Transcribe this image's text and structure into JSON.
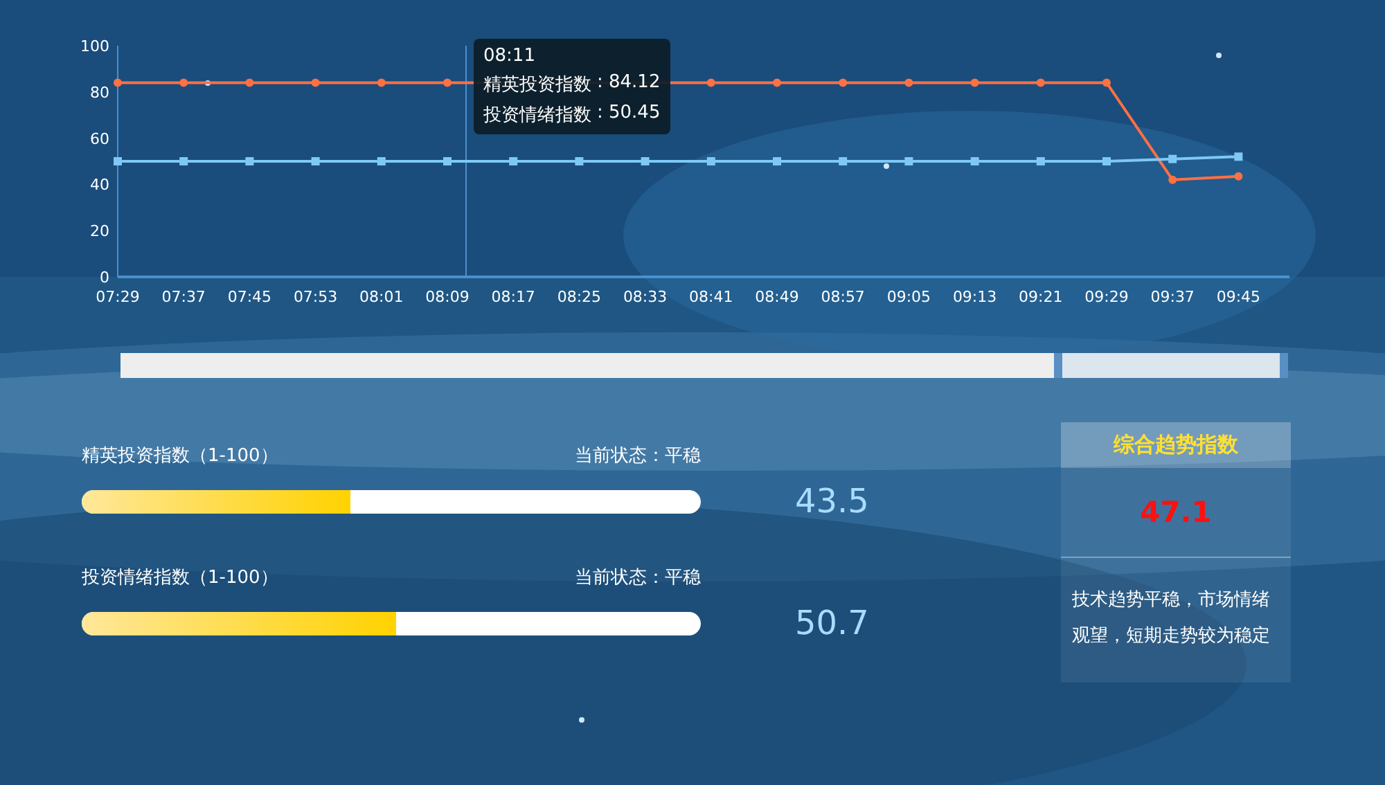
{
  "chart": {
    "chart_data": {
      "type": "line",
      "categories": [
        "07:29",
        "07:37",
        "07:45",
        "07:53",
        "08:01",
        "08:09",
        "08:17",
        "08:25",
        "08:33",
        "08:41",
        "08:49",
        "08:57",
        "09:05",
        "09:13",
        "09:21",
        "09:29",
        "09:37",
        "09:45"
      ],
      "series": [
        {
          "name": "精英投资指数",
          "color": "#ff7043",
          "marker": "circle",
          "values": [
            84,
            84,
            84,
            84,
            84,
            84,
            null,
            null,
            null,
            84,
            84,
            84,
            84,
            84,
            84,
            84,
            42,
            43.5
          ]
        },
        {
          "name": "投资情绪指数",
          "color": "#7ec8f5",
          "marker": "square",
          "values": [
            50,
            50,
            50,
            50,
            50,
            50,
            50,
            50,
            50,
            50,
            50,
            50,
            50,
            50,
            50,
            50,
            51,
            52
          ]
        }
      ],
      "ylim": [
        0,
        100
      ],
      "yticks": [
        0,
        20,
        40,
        60,
        80,
        100
      ]
    },
    "tooltip": {
      "time": "08:11",
      "values": [
        ": 84.12",
        ": 50.45"
      ]
    }
  },
  "zoom": {
    "level": 0.2
  },
  "indices": [
    {
      "label": "精英投资指数（1-100）",
      "status": "当前状态：平稳",
      "level": 0.435,
      "value": "43.5"
    },
    {
      "label": "投资情绪指数（1-100）",
      "status": "当前状态：平稳",
      "level": 0.507,
      "value": "50.7"
    }
  ],
  "summary": {
    "title": "综合趋势指数",
    "value": "47.1",
    "text": "技术趋势平稳，市场情绪观望，短期走势较为稳定"
  }
}
